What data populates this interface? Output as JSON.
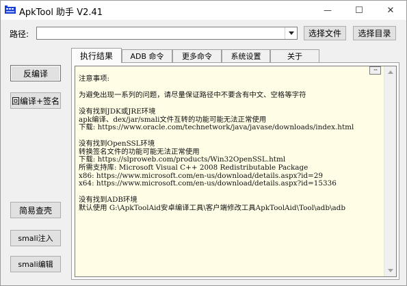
{
  "window": {
    "title": "ApkTool 助手 V2.41",
    "minimize_glyph": "—",
    "maximize_glyph": "☐",
    "close_glyph": "✕"
  },
  "path": {
    "label": "路径:",
    "value": "",
    "select_file_label": "选择文件",
    "select_dir_label": "选择目录"
  },
  "sidebar": {
    "decompile_label": "反编译",
    "recompile_sign_label": "回编译+签名",
    "easy_check_label": "简易查壳",
    "smali_inject_label": "smali注入",
    "smali_edit_label": "smali编辑"
  },
  "tabs": [
    "执行结果",
    "ADB 命令",
    "更多命令",
    "系统设置",
    "关于"
  ],
  "active_tab": 0,
  "output": {
    "more_label": "···",
    "lines": [
      "注意事项:",
      "",
      "为避免出现一系列的问题，请尽量保证路径中不要含有中文、空格等字符",
      "",
      "没有找到JDK或JRE环境",
      "apk编译、dex/jar/smali文件互转的功能可能无法正常使用",
      "下载: https://www.oracle.com/technetwork/java/javase/downloads/index.html",
      "",
      "没有找到OpenSSL环境",
      "转换签名文件的功能可能无法正常使用",
      "下载: https://slproweb.com/products/Win32OpenSSL.html",
      "所需支持库: Microsoft Visual C++ 2008 Redistributable Package",
      "x86: https://www.microsoft.com/en-us/download/details.aspx?id=29",
      "x64: https://www.microsoft.com/en-us/download/details.aspx?id=15336",
      "",
      "没有找到ADB环境",
      "默认使用 G:\\ApkToolAid安卓编译工具\\客户端修改工具ApkToolAid\\Tool\\adb\\adb"
    ]
  },
  "icons": {
    "app": "app-icon",
    "dropdown": "chevron-down-icon",
    "scroll_up": "arrow-up-icon",
    "scroll_down": "arrow-down-icon"
  },
  "colors": {
    "output_background": "#fffde6",
    "window_background": "#f0f0f0",
    "button_face": "#e1e1e1"
  }
}
